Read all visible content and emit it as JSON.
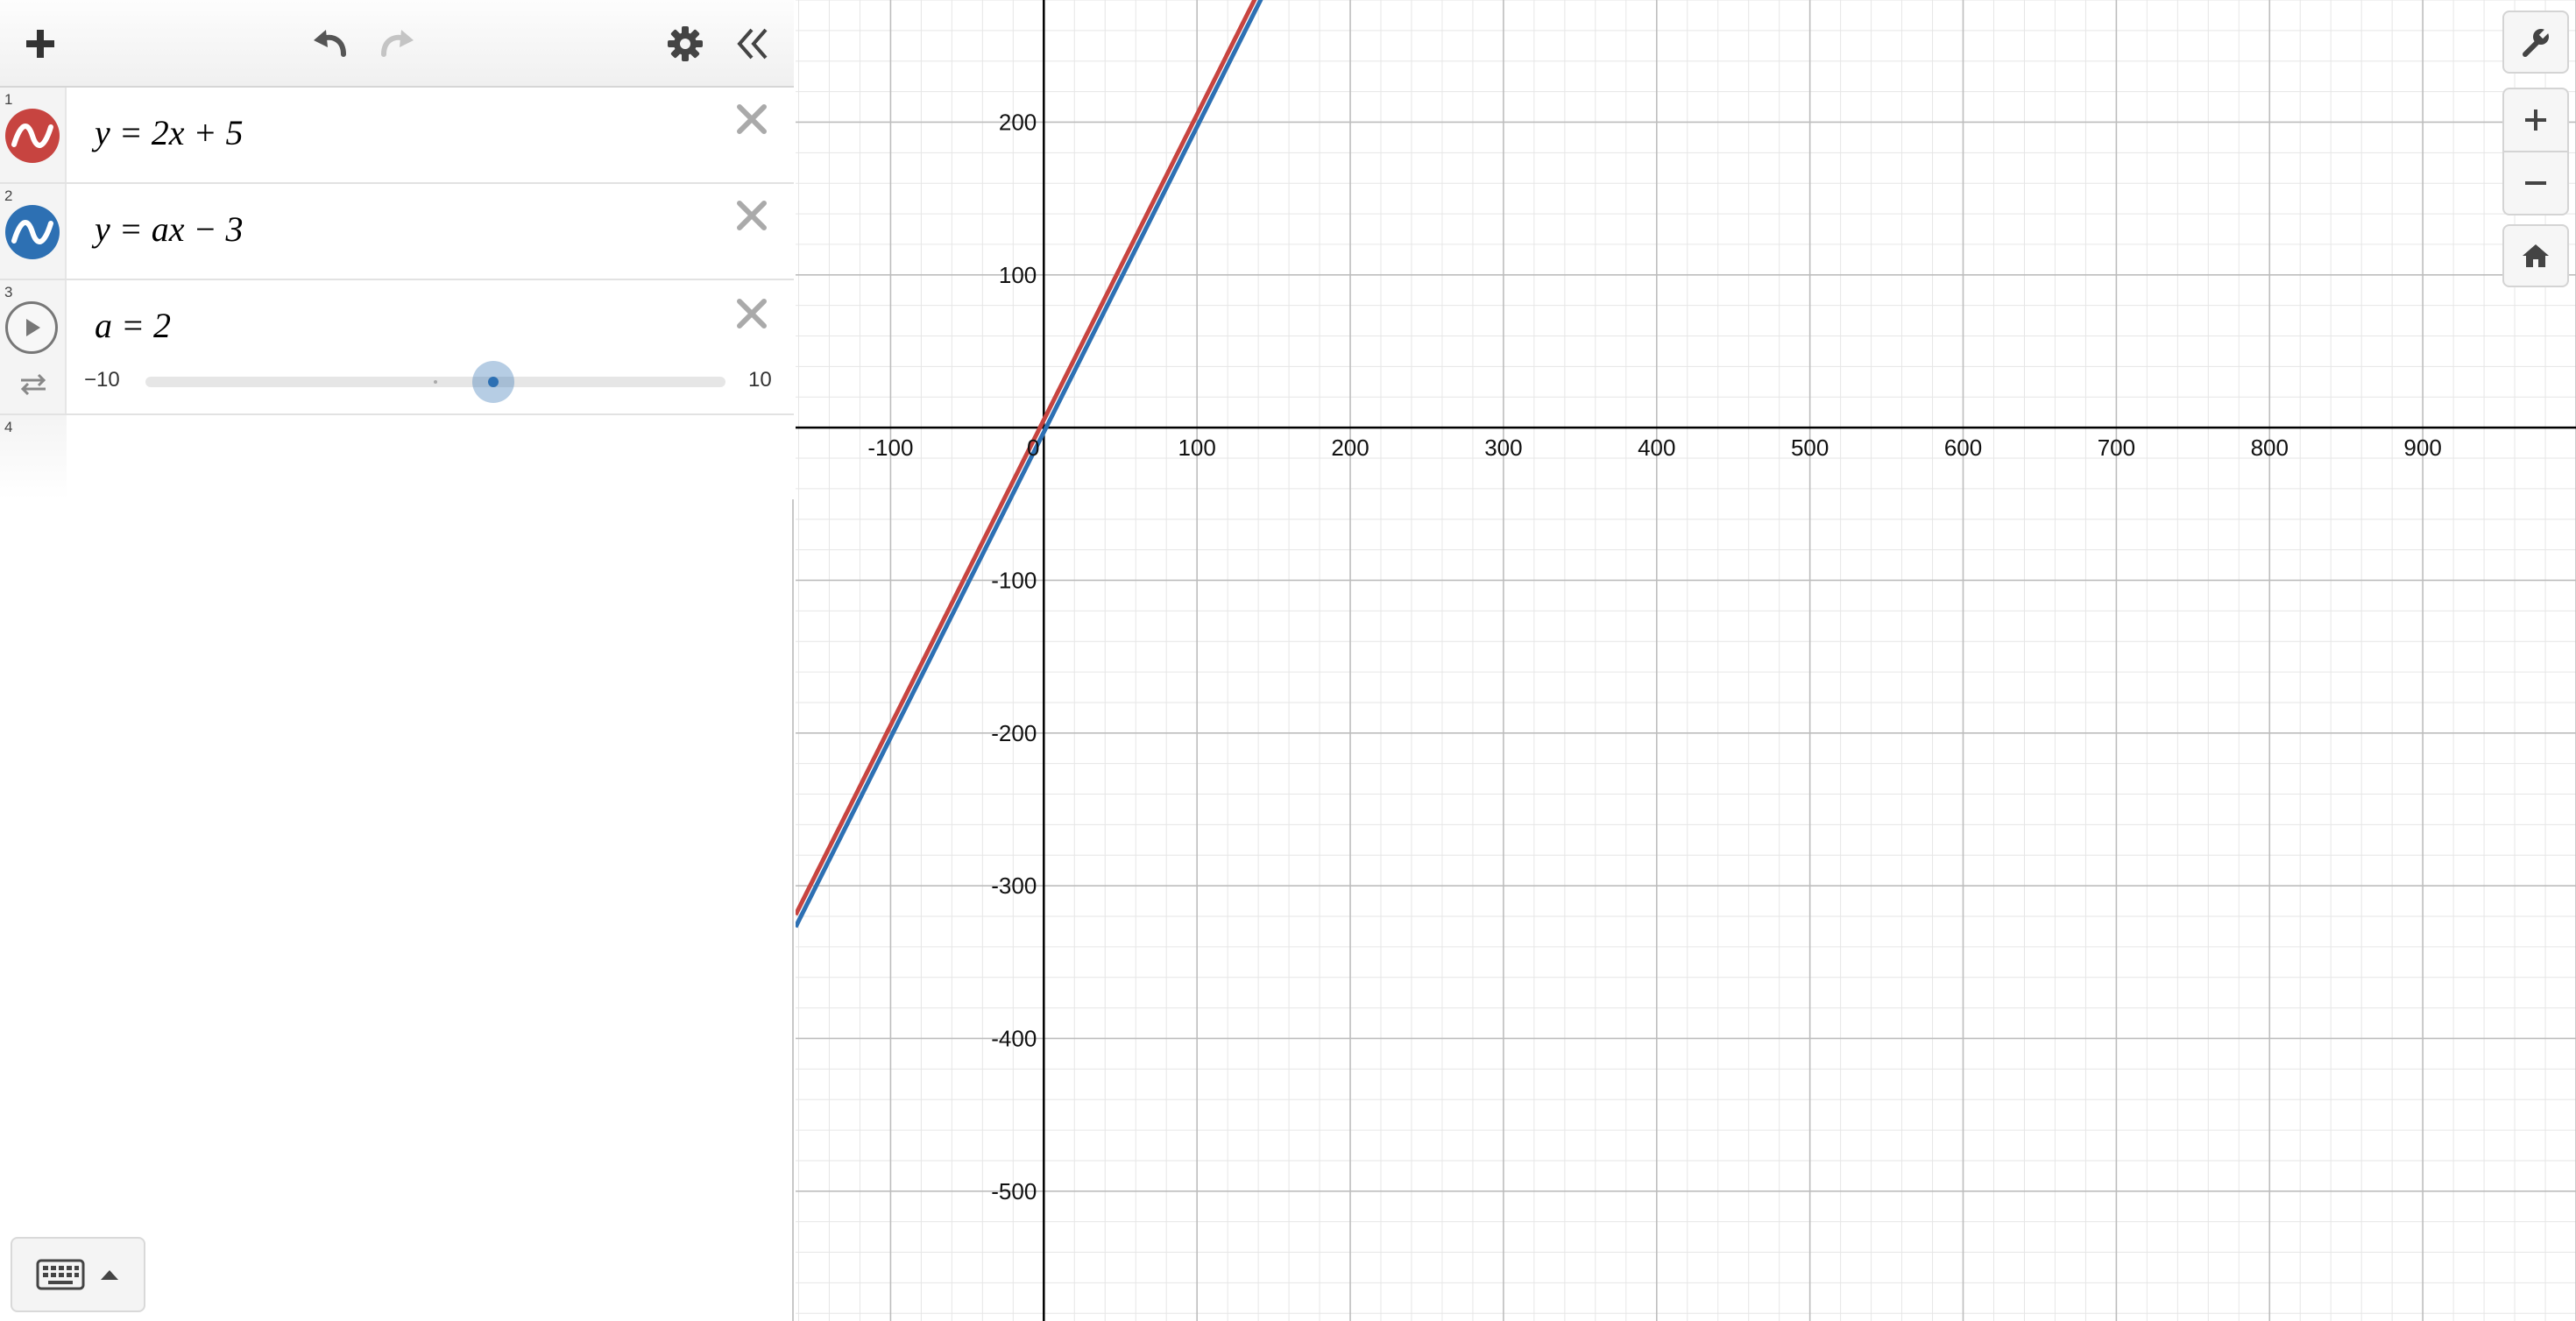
{
  "toolbar": {
    "add_label": "+"
  },
  "expressions": [
    {
      "index": "1",
      "latex": "y = 2x + 5",
      "color": "#c74440",
      "icon": "graph-wave-icon"
    },
    {
      "index": "2",
      "latex": "y = ax − 3",
      "color": "#2d70b3",
      "icon": "graph-wave-icon"
    },
    {
      "index": "3",
      "latex": "a = 2",
      "slider": {
        "min_label": "−10",
        "max_label": "10",
        "value": 2,
        "min": -10,
        "max": 10
      }
    },
    {
      "index": "4",
      "latex": ""
    }
  ],
  "graph": {
    "x_ticks": [
      "-100",
      "0",
      "100",
      "200",
      "300",
      "400",
      "500",
      "600",
      "700",
      "800",
      "900"
    ],
    "y_ticks": [
      "200",
      "100",
      "-100",
      "-200",
      "-300",
      "-400",
      "-500"
    ],
    "x_range": [
      -162,
      1000
    ],
    "y_range": [
      -585,
      280
    ],
    "lines": [
      {
        "name": "y = 2x + 5",
        "slope": 2,
        "intercept": 5,
        "color": "#c74440"
      },
      {
        "name": "y = ax − 3",
        "slope": 2,
        "intercept": -3,
        "color": "#2d70b3"
      }
    ]
  },
  "map_controls": {
    "icons": [
      "wrench-icon",
      "zoom-in-icon",
      "zoom-out-icon",
      "home-icon"
    ]
  }
}
